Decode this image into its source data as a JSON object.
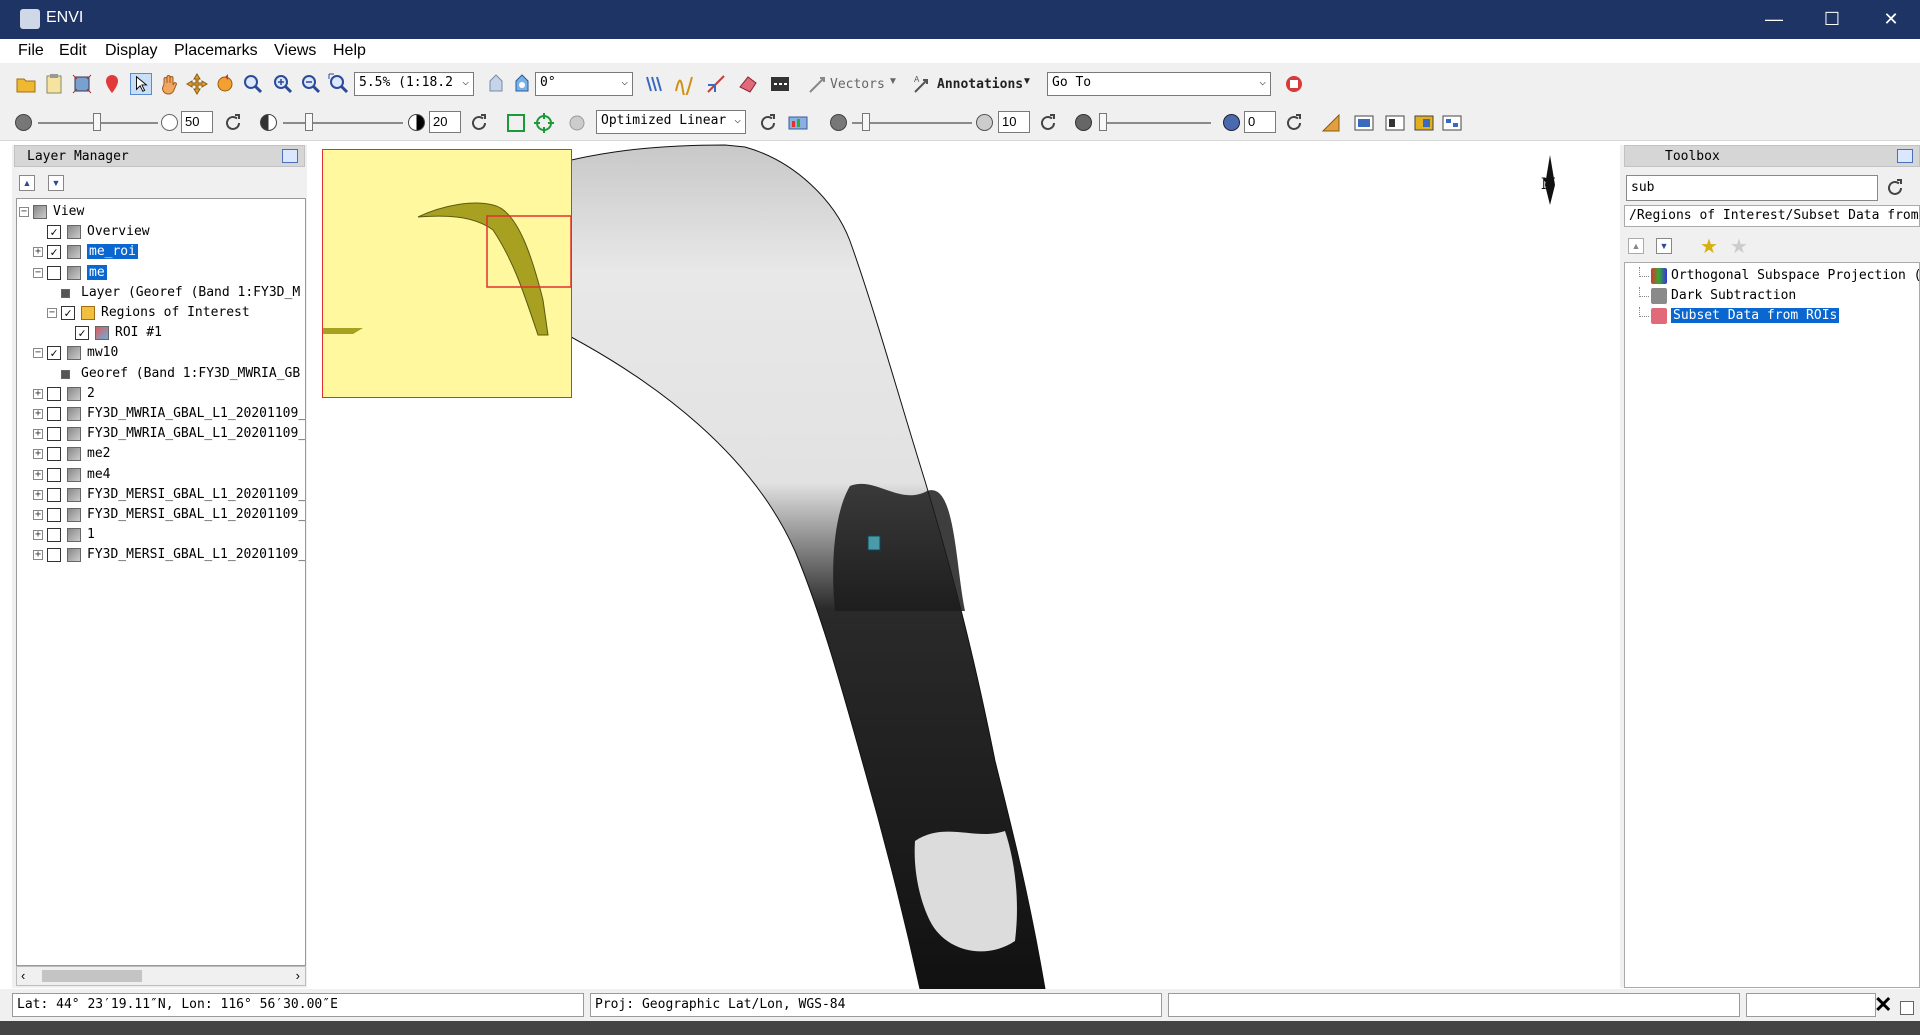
{
  "window": {
    "title": "ENVI"
  },
  "menu": [
    "File",
    "Edit",
    "Display",
    "Placemarks",
    "Views",
    "Help"
  ],
  "toolbar1": {
    "zoom_value": "5.5% (1:18.2",
    "rotation_value": "0°",
    "vectors_label": "Vectors",
    "annotations_label": "Annotations",
    "goto_value": "Go To"
  },
  "toolbar2": {
    "brightness_value": "50",
    "contrast_value": "20",
    "stretch_value": "Optimized Linear",
    "sharpen_value": "10",
    "transparency_value": "0"
  },
  "layer_manager": {
    "title": "Layer Manager",
    "items": [
      {
        "label": "View",
        "level": 0,
        "checked": null,
        "expand": "-",
        "selected": false
      },
      {
        "label": "Overview",
        "level": 1,
        "checked": true,
        "expand": "",
        "selected": false
      },
      {
        "label": "me_roi",
        "level": 1,
        "checked": true,
        "expand": "+",
        "selected": true
      },
      {
        "label": "me",
        "level": 1,
        "checked": false,
        "expand": "-",
        "selected": true
      },
      {
        "label": "Layer (Georef (Band 1:FY3D_M",
        "level": 2,
        "checked": null,
        "expand": "",
        "selected": false
      },
      {
        "label": "Regions of Interest",
        "level": 2,
        "checked": true,
        "expand": "-",
        "selected": false
      },
      {
        "label": "ROI #1",
        "level": 3,
        "checked": true,
        "expand": "",
        "selected": false
      },
      {
        "label": "mw10",
        "level": 1,
        "checked": true,
        "expand": "-",
        "selected": false
      },
      {
        "label": "Georef (Band 1:FY3D_MWRIA_GB",
        "level": 2,
        "checked": null,
        "expand": "",
        "selected": false
      },
      {
        "label": "2",
        "level": 1,
        "checked": false,
        "expand": "+",
        "selected": false
      },
      {
        "label": "FY3D_MWRIA_GBAL_L1_20201109_",
        "level": 1,
        "checked": false,
        "expand": "+",
        "selected": false
      },
      {
        "label": "FY3D_MWRIA_GBAL_L1_20201109_",
        "level": 1,
        "checked": false,
        "expand": "+",
        "selected": false
      },
      {
        "label": "me2",
        "level": 1,
        "checked": false,
        "expand": "+",
        "selected": false
      },
      {
        "label": "me4",
        "level": 1,
        "checked": false,
        "expand": "+",
        "selected": false
      },
      {
        "label": "FY3D_MERSI_GBAL_L1_20201109_",
        "level": 1,
        "checked": false,
        "expand": "+",
        "selected": false
      },
      {
        "label": "FY3D_MERSI_GBAL_L1_20201109_",
        "level": 1,
        "checked": false,
        "expand": "+",
        "selected": false
      },
      {
        "label": "1",
        "level": 1,
        "checked": false,
        "expand": "+",
        "selected": false
      },
      {
        "label": "FY3D_MERSI_GBAL_L1_20201109_",
        "level": 1,
        "checked": false,
        "expand": "+",
        "selected": false
      }
    ]
  },
  "toolbox": {
    "title": "Toolbox",
    "search_value": "sub",
    "path": "/Regions of Interest/Subset Data from I",
    "items": [
      {
        "label": "Orthogonal Subspace Projection (",
        "selected": false
      },
      {
        "label": "Dark Subtraction",
        "selected": false
      },
      {
        "label": "Subset Data from ROIs",
        "selected": true
      }
    ]
  },
  "view": {
    "north_label": "N"
  },
  "status": {
    "coords": "Lat: 44° 23′19.11″N, Lon: 116° 56′30.00″E",
    "projection": "Proj: Geographic Lat/Lon, WGS-84",
    "field3": "",
    "field4": ""
  },
  "colors": {
    "titlebar": "#1e3464",
    "selection": "#0a67d0",
    "overview_bg": "#fff89f",
    "overview_frame": "#e03030"
  }
}
